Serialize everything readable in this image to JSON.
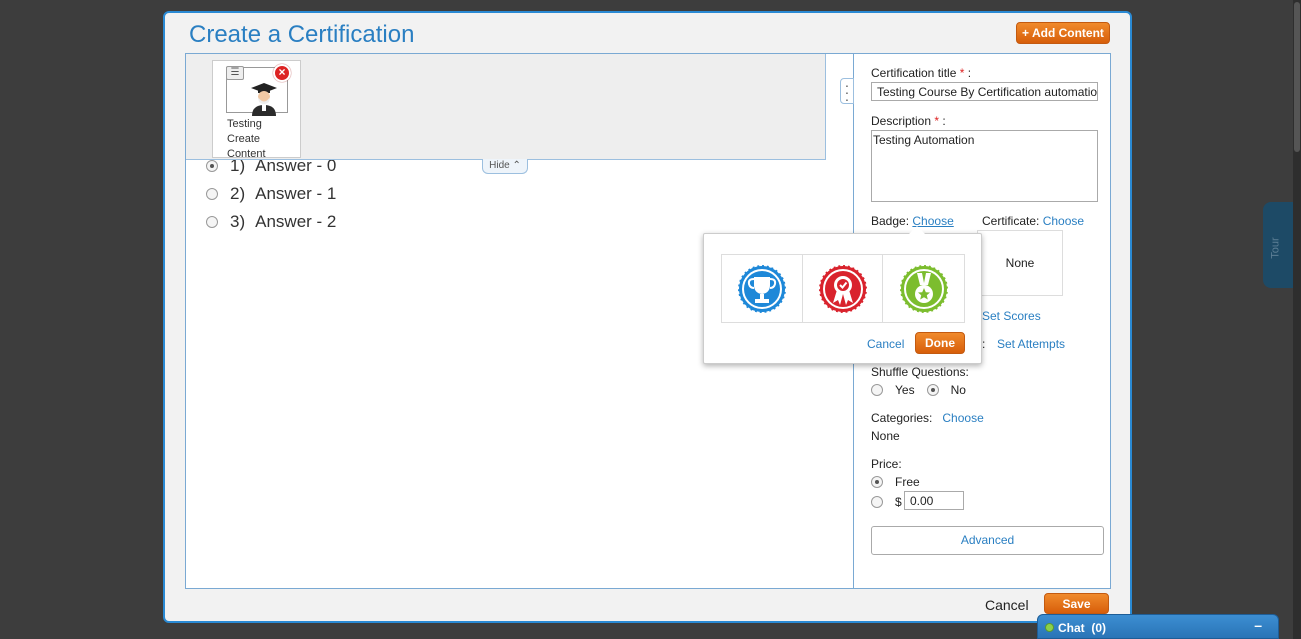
{
  "modal": {
    "title": "Create a Certification",
    "add_content_label": "+ Add Content"
  },
  "content_strip": {
    "card_label_lines": [
      "Testing",
      "Create",
      "Content"
    ],
    "menu_icon": "menu-icon",
    "remove_icon": "remove-icon",
    "hide_label": "Hide"
  },
  "answers": [
    {
      "number": "1)",
      "text": "Answer - 0",
      "selected": true
    },
    {
      "number": "2)",
      "text": "Answer - 1",
      "selected": false
    },
    {
      "number": "3)",
      "text": "Answer - 2",
      "selected": false
    }
  ],
  "form": {
    "cert_title_label": "Certification title",
    "cert_title_req": "*",
    "cert_title_suffix": ":",
    "cert_title_value": "Testing Course By Certification automatio",
    "description_label": "Description",
    "description_req": "*",
    "description_suffix": ":",
    "description_value": "Testing Automation",
    "badge_label": "Badge:",
    "badge_choose": "Choose",
    "certificate_label": "Certificate:",
    "certificate_choose": "Choose",
    "certificate_value": "None",
    "set_scores": "Set Scores",
    "attempts_colon": ":",
    "set_attempts": "Set Attempts",
    "shuffle_label": "Shuffle Questions:",
    "shuffle_yes": "Yes",
    "shuffle_no": "No",
    "shuffle_selected": "No",
    "categories_label": "Categories:",
    "categories_choose": "Choose",
    "categories_value": "None",
    "price_label": "Price:",
    "price_free": "Free",
    "price_currency": "$",
    "price_value": "0.00",
    "price_selected": "Free",
    "advanced_label": "Advanced"
  },
  "badge_popover": {
    "badges": [
      "trophy-badge-icon",
      "ribbon-badge-icon",
      "star-medal-badge-icon"
    ],
    "badge_colors": [
      "#1e88d8",
      "#d9232d",
      "#7cbd2e"
    ],
    "cancel_label": "Cancel",
    "done_label": "Done"
  },
  "footer": {
    "cancel_label": "Cancel",
    "save_label": "Save"
  },
  "chat": {
    "label": "Chat",
    "count": "(0)",
    "minimize": "–"
  },
  "tour_label": "Tour"
}
